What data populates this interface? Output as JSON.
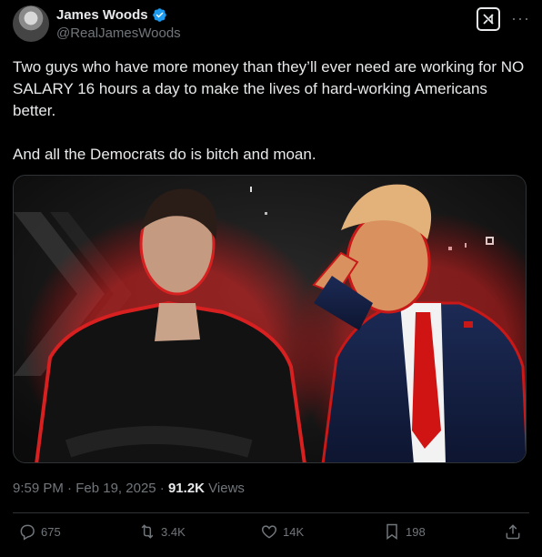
{
  "author": {
    "name": "James Woods",
    "handle": "@RealJamesWoods",
    "verified": true
  },
  "tweet": {
    "text": "Two guys who have more money than they’ll ever need are working for NO SALARY 16 hours a day to make the lives of hard-working Americans better.\n\nAnd all the Democrats do is bitch and moan."
  },
  "meta": {
    "time": "9:59 PM",
    "date": "Feb 19, 2025",
    "views_count": "91.2K",
    "views_label": "Views"
  },
  "actions": {
    "replies": "675",
    "reposts": "3.4K",
    "likes": "14K",
    "bookmarks": "198"
  },
  "colors": {
    "background": "#000000",
    "text": "#e7e9ea",
    "secondary": "#71767b",
    "verified": "#1d9bf0",
    "divider": "#2f3336"
  },
  "icons": {
    "grok": "grok-icon",
    "more": "more-icon",
    "reply": "reply-icon",
    "repost": "repost-icon",
    "like": "heart-icon",
    "bookmark": "bookmark-icon",
    "share": "share-icon"
  }
}
